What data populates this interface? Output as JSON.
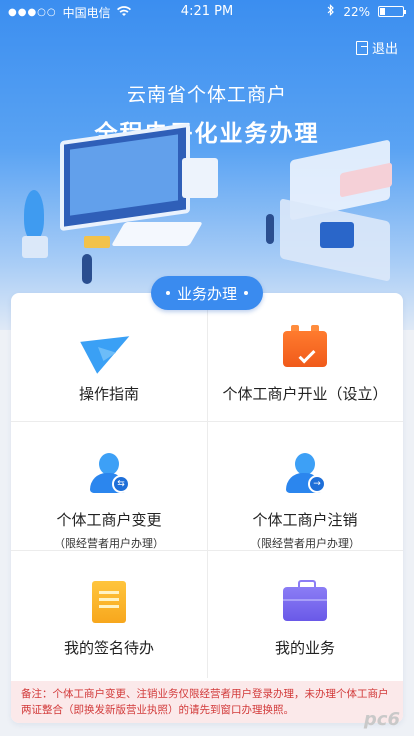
{
  "status_bar": {
    "signal": "●●●○○",
    "carrier": "中国电信",
    "time": "4:21 PM",
    "battery": "22%"
  },
  "header": {
    "logout_label": "退出",
    "headline_line1": "云南省个体工商户",
    "headline_line2": "全程电子化业务办理"
  },
  "section": {
    "title": "业务办理"
  },
  "services": [
    {
      "title": "操作指南",
      "sub": "",
      "icon": "paper-plane-icon"
    },
    {
      "title": "个体工商户开业（设立）",
      "sub": "",
      "icon": "briefcase-check-icon"
    },
    {
      "title": "个体工商户变更",
      "sub": "（限经营者用户办理）",
      "icon": "user-change-icon"
    },
    {
      "title": "个体工商户注销",
      "sub": "（限经营者用户办理）",
      "icon": "user-cancel-icon"
    },
    {
      "title": "我的签名待办",
      "sub": "",
      "icon": "document-sign-icon"
    },
    {
      "title": "我的业务",
      "sub": "",
      "icon": "briefcase-icon"
    }
  ],
  "note": {
    "text": "备注：个体工商户变更、注销业务仅限经营者用户登录办理，未办理个体工商户两证整合（即换发新版营业执照）的请先到窗口办理换照。"
  },
  "watermark": "pc6",
  "colors": {
    "primary": "#3a8bef",
    "note_bg": "#fbe9ea",
    "note_text": "#d23a3a"
  }
}
